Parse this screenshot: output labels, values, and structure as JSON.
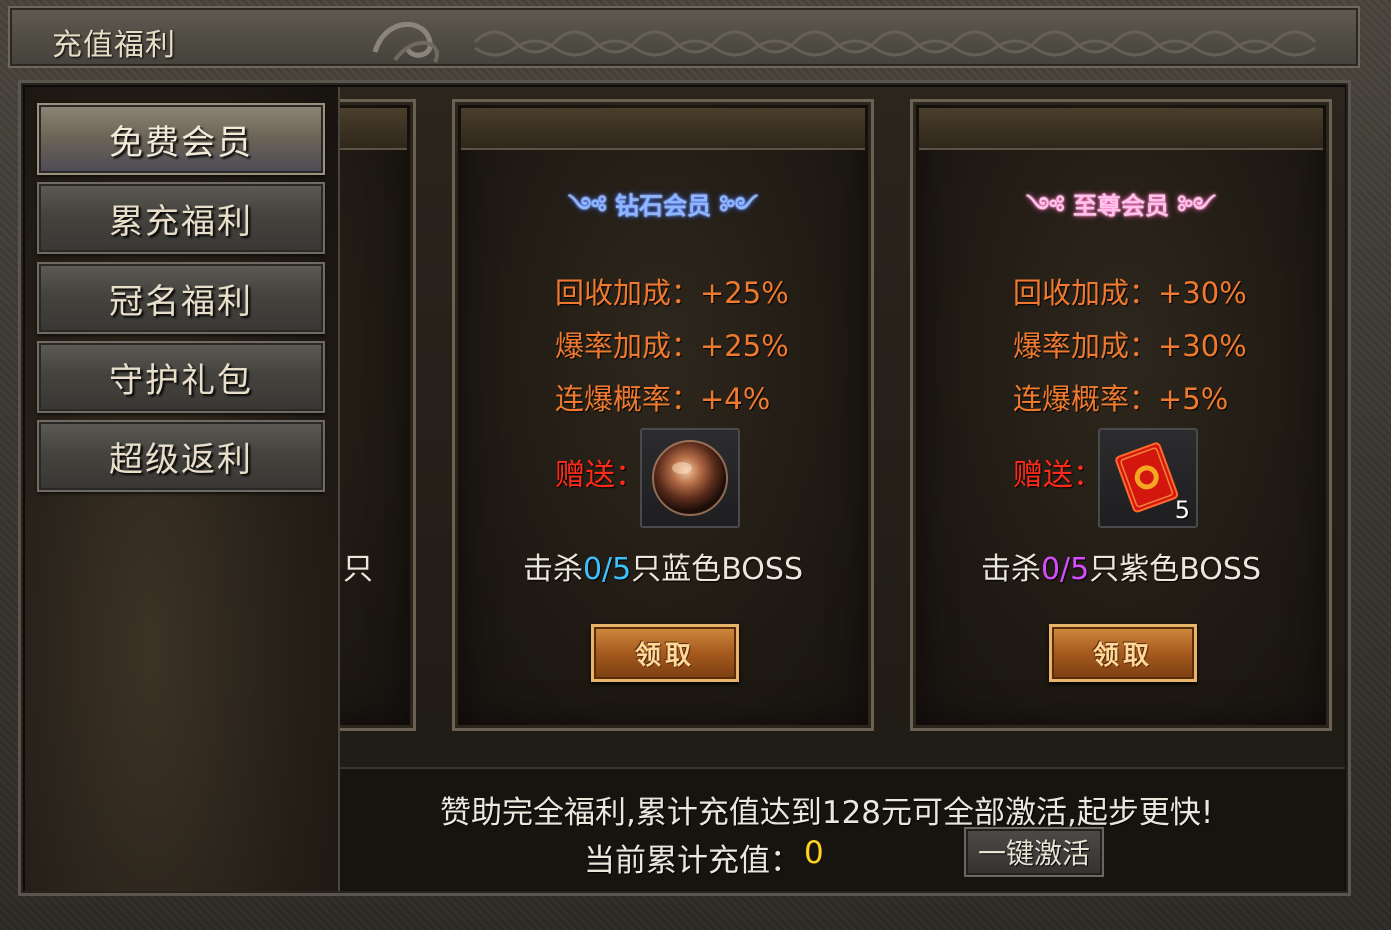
{
  "window": {
    "title": "充值福利"
  },
  "sidebar": {
    "items": [
      {
        "label": "免费会员",
        "active": true
      },
      {
        "label": "累充福利",
        "active": false
      },
      {
        "label": "冠名福利",
        "active": false
      },
      {
        "label": "守护礼包",
        "active": false
      },
      {
        "label": "超级返利",
        "active": false
      }
    ]
  },
  "partial_card": {
    "fragment_text": "只"
  },
  "cards": [
    {
      "emblem": "钻石会员",
      "stats": [
        "回收加成：+25%",
        "爆率加成：+25%",
        "连爆概率：+4%"
      ],
      "gift_label": "赠送：",
      "gift_icon": "bronze-orb-icon",
      "gift_count": "",
      "kill_prefix": "击杀",
      "kill_count": "0/5",
      "kill_suffix": "只蓝色BOSS",
      "claim_label": "领取",
      "accent": "#3cc0ff"
    },
    {
      "emblem": "至尊会员",
      "stats": [
        "回收加成：+30%",
        "爆率加成：+30%",
        "连爆概率：+5%"
      ],
      "gift_label": "赠送：",
      "gift_icon": "red-envelope-icon",
      "gift_count": "5",
      "kill_prefix": "击杀",
      "kill_count": "0/5",
      "kill_suffix": "只紫色BOSS",
      "claim_label": "领取",
      "accent": "#d84cff"
    }
  ],
  "footer": {
    "sponsor_text": "赞助完全福利,累计充值达到128元可全部激活,起步更快!",
    "total_label": "当前累计充值：",
    "total_value": "0",
    "activate_label": "一键激活"
  },
  "colors": {
    "stat_orange": "#ef7a2f",
    "gift_red": "#ff2a17",
    "value_yellow": "#ffd21e"
  }
}
